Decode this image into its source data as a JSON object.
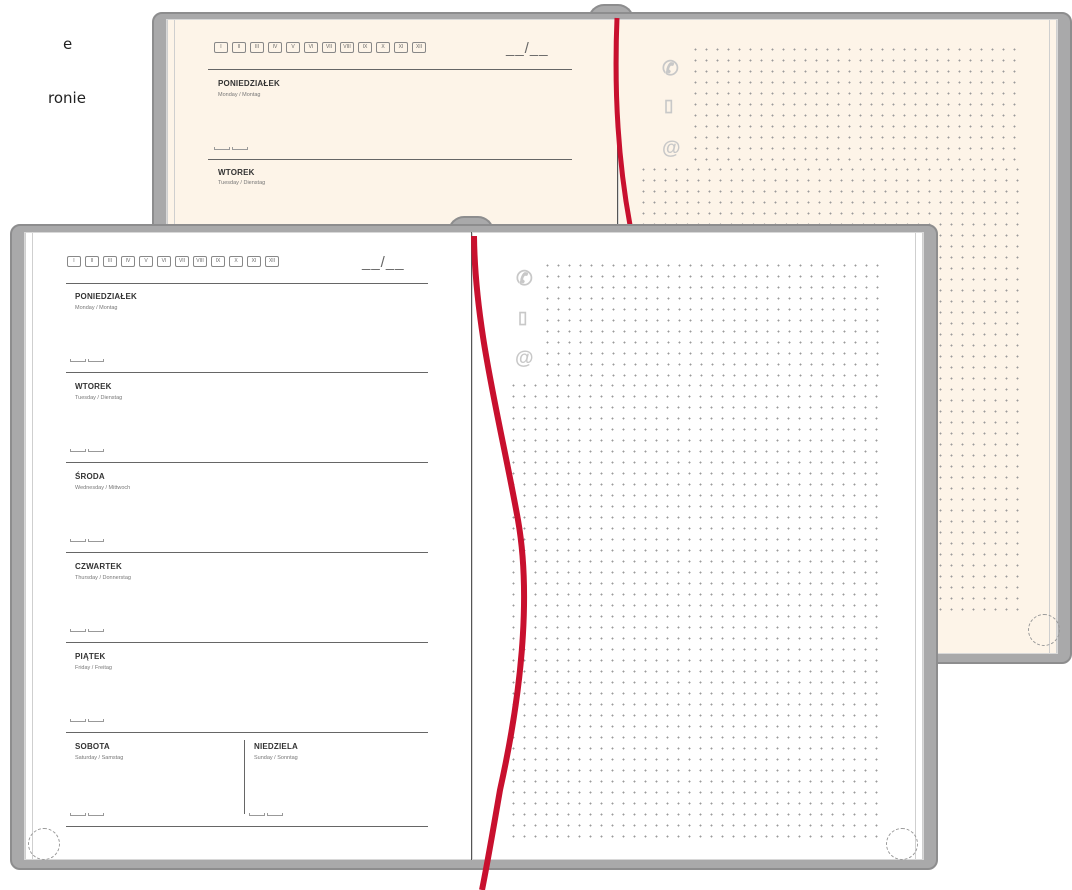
{
  "corner_text": [
    "e",
    "ronie"
  ],
  "months": [
    "I",
    "II",
    "III",
    "IV",
    "V",
    "VI",
    "VII",
    "VIII",
    "IX",
    "X",
    "XI",
    "XII"
  ],
  "date_placeholder": "__/__",
  "back_days": [
    {
      "name": "PONIEDZIAŁEK",
      "sub": "Monday / Montag"
    },
    {
      "name": "WTOREK",
      "sub": "Tuesday / Dienstag"
    }
  ],
  "front_days": [
    {
      "name": "PONIEDZIAŁEK",
      "sub": "Monday / Montag"
    },
    {
      "name": "WTOREK",
      "sub": "Tuesday / Dienstag"
    },
    {
      "name": "ŚRODA",
      "sub": "Wednesday / Mittwoch"
    },
    {
      "name": "CZWARTEK",
      "sub": "Thursday / Donnerstag"
    },
    {
      "name": "PIĄTEK",
      "sub": "Friday / Freitag"
    }
  ],
  "weekend": [
    {
      "name": "SOBOTA",
      "sub": "Saturday / Samstag"
    },
    {
      "name": "NIEDZIELA",
      "sub": "Sunday / Sonntag"
    }
  ],
  "icons": [
    "phone-icon",
    "mobile-icon",
    "at-icon"
  ],
  "icon_glyphs": {
    "phone": "✆",
    "mobile": "☐",
    "at": "@"
  },
  "colors": {
    "cover": "#a9a9aa",
    "ribbon": "#c8102e",
    "cream": "#fdf4e8",
    "paper": "#ffffff"
  }
}
